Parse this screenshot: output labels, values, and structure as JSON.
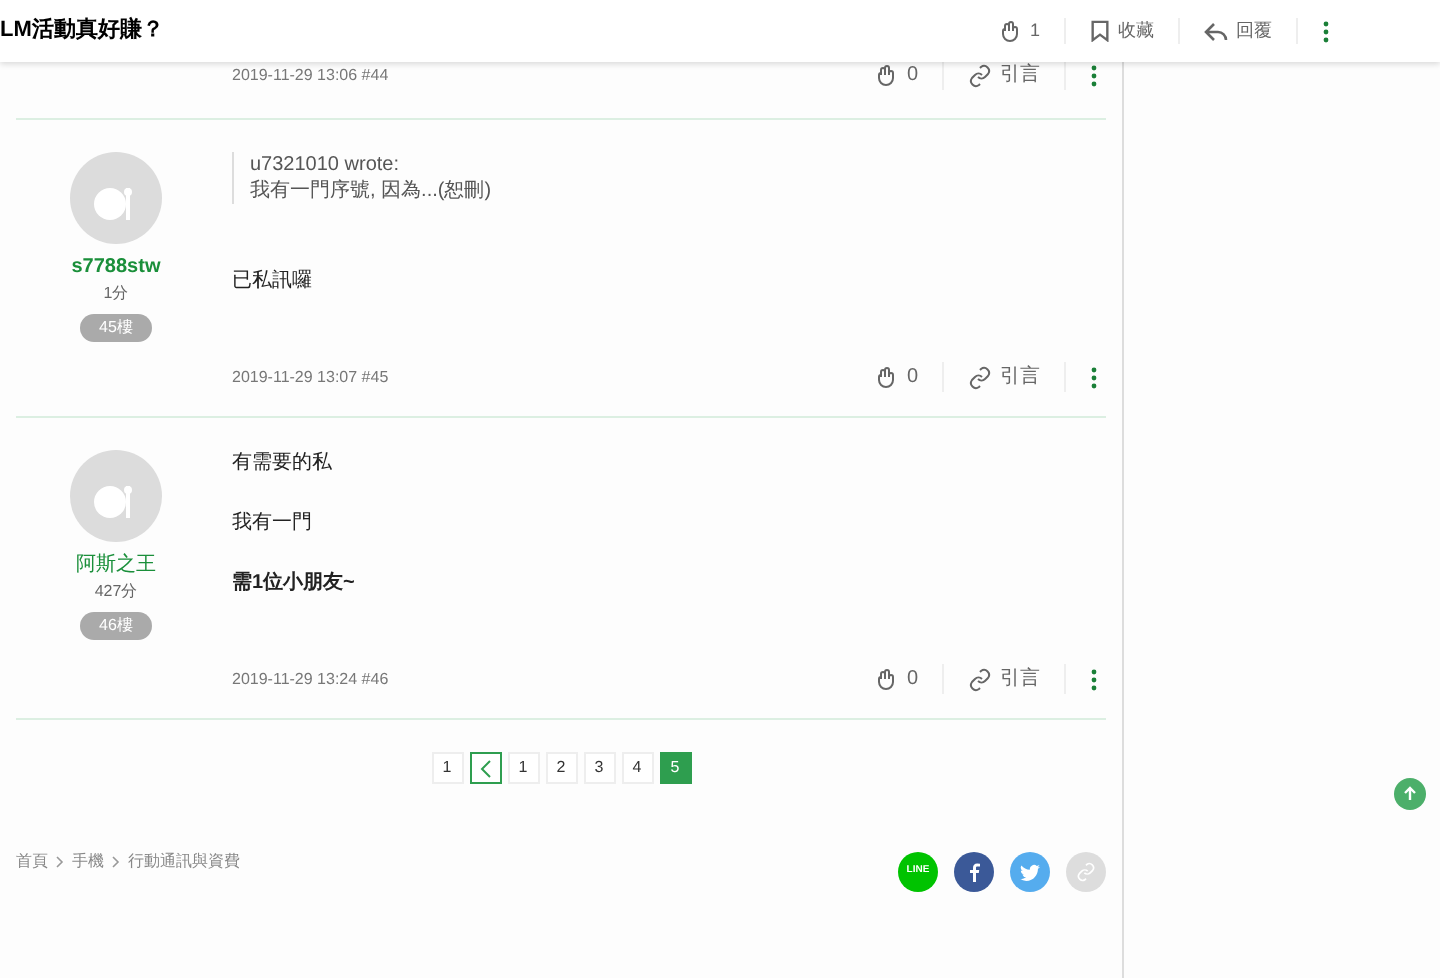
{
  "header": {
    "title": "LM活動真好賺？",
    "likes": "1",
    "favorite": "收藏",
    "reply": "回覆"
  },
  "partial_post": {
    "meta": "2019-11-29 13:06 #44",
    "likes": "0",
    "quote": "引言"
  },
  "posts": [
    {
      "user": "s7788stw",
      "user_bold": true,
      "score": "1分",
      "floor": "45樓",
      "quote": {
        "author": "u7321010 wrote:",
        "text": "我有一門序號, 因為...(恕刪)"
      },
      "lines": [
        {
          "text": "已私訊囉",
          "bold": false
        }
      ],
      "meta": "2019-11-29 13:07 #45",
      "likes": "0",
      "quote_label": "引言"
    },
    {
      "user": "阿斯之王",
      "user_bold": false,
      "score": "427分",
      "floor": "46樓",
      "lines": [
        {
          "text": "有需要的私",
          "bold": false
        },
        {
          "text": "我有一門",
          "bold": false
        },
        {
          "text": "需1位小朋友~",
          "bold": true
        }
      ],
      "meta": "2019-11-29 13:24 #46",
      "likes": "0",
      "quote_label": "引言"
    }
  ],
  "pagination": [
    {
      "kind": "page",
      "label": "1",
      "selected": false
    },
    {
      "kind": "prev",
      "selected": false
    },
    {
      "kind": "page",
      "label": "1",
      "selected": false
    },
    {
      "kind": "page",
      "label": "2",
      "selected": false
    },
    {
      "kind": "page",
      "label": "3",
      "selected": false
    },
    {
      "kind": "page",
      "label": "4",
      "selected": false
    },
    {
      "kind": "page",
      "label": "5",
      "selected": true
    }
  ],
  "breadcrumb": [
    "首頁",
    "手機",
    "行動通訊與資費"
  ],
  "share": [
    {
      "kind": "line",
      "label": "LINE"
    },
    {
      "kind": "facebook"
    },
    {
      "kind": "twitter"
    },
    {
      "kind": "link"
    }
  ]
}
